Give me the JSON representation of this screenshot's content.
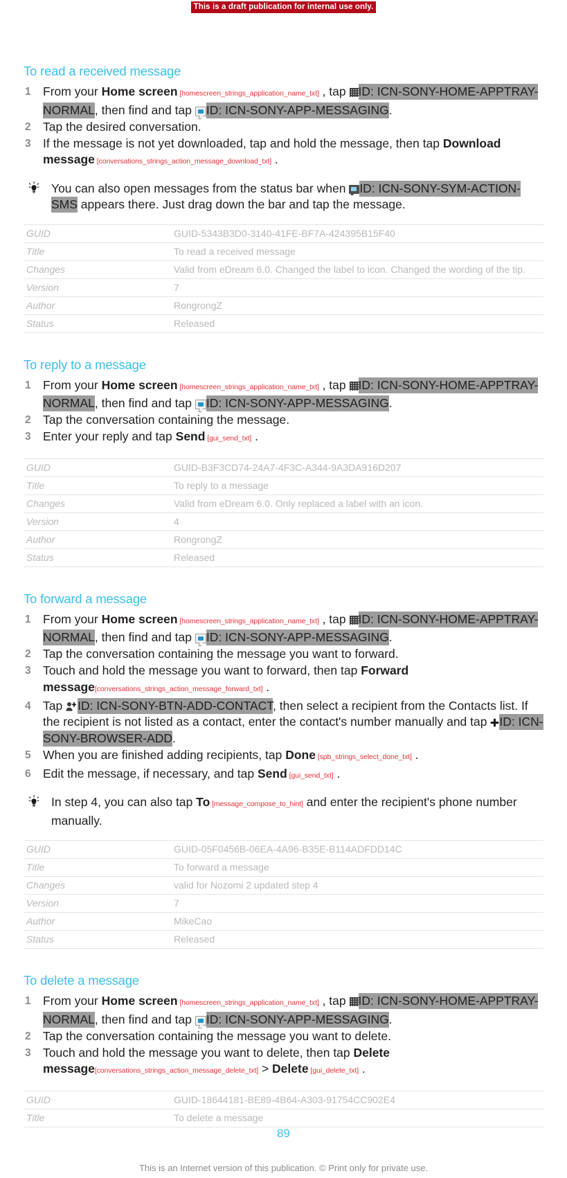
{
  "banner": {
    "text": "This is a draft publication for internal use only."
  },
  "sections": [
    {
      "title": "To read a received message",
      "steps": [
        {
          "num": "1",
          "parts": [
            {
              "t": "text",
              "v": "From your "
            },
            {
              "t": "bold",
              "v": "Home screen"
            },
            {
              "t": "sid",
              "v": "[homescreen_strings_application_name_txt]"
            },
            {
              "t": "text",
              "v": ", tap "
            },
            {
              "t": "icon",
              "v": "apptray-icon"
            },
            {
              "t": "id",
              "v": "ID: ICN-SONY-HOME-APPTRAY-NORMAL"
            },
            {
              "t": "text",
              "v": ", then find and tap "
            },
            {
              "t": "icon",
              "v": "messaging-app-icon"
            },
            {
              "t": "id",
              "v": "ID: ICN-SONY-APP-MESSAGING"
            },
            {
              "t": "text",
              "v": "."
            }
          ]
        },
        {
          "num": "2",
          "parts": [
            {
              "t": "text",
              "v": "Tap the desired conversation."
            }
          ]
        },
        {
          "num": "3",
          "parts": [
            {
              "t": "text",
              "v": "If the message is not yet downloaded, tap and hold the message, then tap "
            },
            {
              "t": "bold",
              "v": "Download message"
            },
            {
              "t": "sid",
              "v": "[conversations_strings_action_message_download_txt]"
            },
            {
              "t": "text",
              "v": "."
            }
          ]
        }
      ],
      "tip": [
        {
          "t": "text",
          "v": "You can also open messages from the status bar when "
        },
        {
          "t": "icon",
          "v": "sms-status-icon"
        },
        {
          "t": "id",
          "v": "ID: ICN-SONY-SYM-ACTION-SMS"
        },
        {
          "t": "text",
          "v": " appears there. Just drag down the bar and tap the message."
        }
      ],
      "meta": {
        "keys": [
          "GUID",
          "Title",
          "Changes",
          "Version",
          "Author",
          "Status"
        ],
        "values": [
          "GUID-5343B3D0-3140-41FE-BF7A-424395B15F40",
          "To read a received message",
          "Valid from eDream 6.0. Changed the label to icon. Changed the wording of the tip.",
          "7",
          "RongrongZ",
          "Released"
        ]
      }
    },
    {
      "title": "To reply to a message",
      "steps": [
        {
          "num": "1",
          "parts": [
            {
              "t": "text",
              "v": "From your "
            },
            {
              "t": "bold",
              "v": "Home screen"
            },
            {
              "t": "sid",
              "v": "[homescreen_strings_application_name_txt]"
            },
            {
              "t": "text",
              "v": ", tap "
            },
            {
              "t": "icon",
              "v": "apptray-icon"
            },
            {
              "t": "id",
              "v": "ID: ICN-SONY-HOME-APPTRAY-NORMAL"
            },
            {
              "t": "text",
              "v": ", then find and tap "
            },
            {
              "t": "icon",
              "v": "messaging-app-icon"
            },
            {
              "t": "id",
              "v": "ID: ICN-SONY-APP-MESSAGING"
            },
            {
              "t": "text",
              "v": "."
            }
          ]
        },
        {
          "num": "2",
          "parts": [
            {
              "t": "text",
              "v": "Tap the conversation containing the message."
            }
          ]
        },
        {
          "num": "3",
          "parts": [
            {
              "t": "text",
              "v": "Enter your reply and tap "
            },
            {
              "t": "bold",
              "v": "Send"
            },
            {
              "t": "sid",
              "v": "[gui_send_txt]"
            },
            {
              "t": "text",
              "v": "."
            }
          ]
        }
      ],
      "tip": null,
      "meta": {
        "keys": [
          "GUID",
          "Title",
          "Changes",
          "Version",
          "Author",
          "Status"
        ],
        "values": [
          "GUID-B3F3CD74-24A7-4F3C-A344-9A3DA916D207",
          "To reply to a message",
          "Valid from eDream 6.0. Only replaced a label with an icon.",
          "4",
          "RongrongZ",
          "Released"
        ]
      }
    },
    {
      "title": "To forward a message",
      "steps": [
        {
          "num": "1",
          "parts": [
            {
              "t": "text",
              "v": "From your "
            },
            {
              "t": "bold",
              "v": "Home screen"
            },
            {
              "t": "sid",
              "v": "[homescreen_strings_application_name_txt]"
            },
            {
              "t": "text",
              "v": ", tap "
            },
            {
              "t": "icon",
              "v": "apptray-icon"
            },
            {
              "t": "id",
              "v": "ID: ICN-SONY-HOME-APPTRAY-NORMAL"
            },
            {
              "t": "text",
              "v": ", then find and tap "
            },
            {
              "t": "icon",
              "v": "messaging-app-icon"
            },
            {
              "t": "id",
              "v": "ID: ICN-SONY-APP-MESSAGING"
            },
            {
              "t": "text",
              "v": "."
            }
          ]
        },
        {
          "num": "2",
          "parts": [
            {
              "t": "text",
              "v": "Tap the conversation containing the message you want to forward."
            }
          ]
        },
        {
          "num": "3",
          "parts": [
            {
              "t": "text",
              "v": "Touch and hold the message you want to forward, then tap "
            },
            {
              "t": "bold",
              "v": "Forward message"
            },
            {
              "t": "sid-block",
              "v": "[conversations_strings_action_message_forward_txt]"
            },
            {
              "t": "text",
              "v": "."
            }
          ]
        },
        {
          "num": "4",
          "parts": [
            {
              "t": "text",
              "v": "Tap "
            },
            {
              "t": "icon",
              "v": "add-contact-icon"
            },
            {
              "t": "id",
              "v": "ID: ICN-SONY-BTN-ADD-CONTACT"
            },
            {
              "t": "text",
              "v": ", then select a recipient from the Contacts list. If the recipient is not listed as a contact, enter the contact's number manually and tap "
            },
            {
              "t": "icon",
              "v": "browser-add-icon"
            },
            {
              "t": "id",
              "v": "ID: ICN-SONY-BROWSER-ADD"
            },
            {
              "t": "text",
              "v": "."
            }
          ]
        },
        {
          "num": "5",
          "parts": [
            {
              "t": "text",
              "v": "When you are finished adding recipients, tap "
            },
            {
              "t": "bold",
              "v": "Done"
            },
            {
              "t": "sid",
              "v": "[spb_strings_select_done_txt]"
            },
            {
              "t": "text",
              "v": "."
            }
          ]
        },
        {
          "num": "6",
          "parts": [
            {
              "t": "text",
              "v": "Edit the message, if necessary, and tap "
            },
            {
              "t": "bold",
              "v": "Send"
            },
            {
              "t": "sid",
              "v": "[gui_send_txt]"
            },
            {
              "t": "text",
              "v": "."
            }
          ]
        }
      ],
      "tip": [
        {
          "t": "text",
          "v": "In step 4, you can also tap "
        },
        {
          "t": "bold",
          "v": "To"
        },
        {
          "t": "sid",
          "v": "[message_compose_to_hint]"
        },
        {
          "t": "text",
          "v": " and enter the recipient's phone number manually."
        }
      ],
      "meta": {
        "keys": [
          "GUID",
          "Title",
          "Changes",
          "Version",
          "Author",
          "Status"
        ],
        "values": [
          "GUID-05F0456B-06EA-4A96-B35E-B114ADFDD14C",
          "To forward a message",
          "valid for Nozomi 2 updated step 4",
          "7",
          "MikeCao",
          "Released"
        ]
      }
    },
    {
      "title": "To delete a message",
      "steps": [
        {
          "num": "1",
          "parts": [
            {
              "t": "text",
              "v": "From your "
            },
            {
              "t": "bold",
              "v": "Home screen"
            },
            {
              "t": "sid",
              "v": "[homescreen_strings_application_name_txt]"
            },
            {
              "t": "text",
              "v": ", tap "
            },
            {
              "t": "icon",
              "v": "apptray-icon"
            },
            {
              "t": "id",
              "v": "ID: ICN-SONY-HOME-APPTRAY-NORMAL"
            },
            {
              "t": "text",
              "v": ", then find and tap "
            },
            {
              "t": "icon",
              "v": "messaging-app-icon"
            },
            {
              "t": "id",
              "v": "ID: ICN-SONY-APP-MESSAGING"
            },
            {
              "t": "text",
              "v": "."
            }
          ]
        },
        {
          "num": "2",
          "parts": [
            {
              "t": "text",
              "v": "Tap the conversation containing the message you want to delete."
            }
          ]
        },
        {
          "num": "3",
          "parts": [
            {
              "t": "text",
              "v": "Touch and hold the message you want to delete, then tap "
            },
            {
              "t": "bold",
              "v": "Delete message"
            },
            {
              "t": "sid-wrap",
              "v": "[conversations_strings_action_message_delete_txt]"
            },
            {
              "t": "text",
              "v": " > "
            },
            {
              "t": "bold",
              "v": "Delete"
            },
            {
              "t": "sid",
              "v": "[gui_delete_txt]"
            },
            {
              "t": "text",
              "v": "."
            }
          ]
        }
      ],
      "tip": null,
      "meta": {
        "keys": [
          "GUID",
          "Title"
        ],
        "values": [
          "GUID-18644181-BE89-4B64-A303-91754CC902E4",
          "To delete a message"
        ]
      }
    }
  ],
  "footer": {
    "page_number": "89",
    "note": "This is an Internet version of this publication. © Print only for private use."
  },
  "colors": {
    "heading": "#3bbfe8",
    "banner_bg": "#b4091a",
    "string_id": "#e8333a",
    "id_highlight": "#9c9c9c",
    "meta_text": "#b9b9b9"
  }
}
